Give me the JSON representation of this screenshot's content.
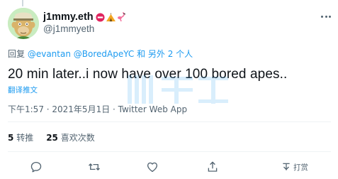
{
  "tweet": {
    "display_name": "j1mmy.eth",
    "handle": "@j1mmyeth",
    "reply_prefix": "回复 ",
    "reply_mentions": "@evantan @BoredApeYC",
    "reply_suffix": " 和 另外 2 个人",
    "text": "20 min later..i now have over 100 bored apes..",
    "translate_label": "翻译推文",
    "timestamp": "下午1:57 · 2021年5月1日 · Twitter Web App",
    "retweet_count": "5",
    "retweet_label": "转推",
    "like_count": "25",
    "like_label": "喜欢次数"
  },
  "actions": {
    "tip_label": "打赏"
  },
  "icons": {
    "avatar": "bored-ape-avatar",
    "emojis": [
      "no-entry-icon",
      "tent-icon",
      "flamingo-icon"
    ],
    "more": "more-dots-icon",
    "reply": "reply-icon",
    "retweet": "retweet-icon",
    "like": "heart-icon",
    "share": "share-icon",
    "tip": "tip-icon"
  },
  "colors": {
    "accent": "#1d9bf0",
    "secondary_text": "#536471",
    "primary_text": "#0f1419",
    "divider": "#eff3f4"
  }
}
